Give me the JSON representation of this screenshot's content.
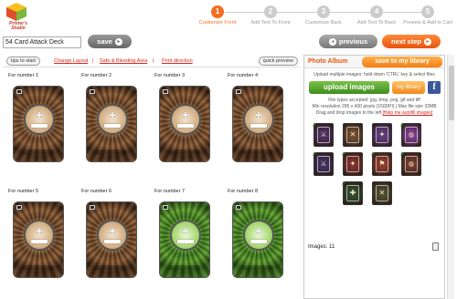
{
  "brand": {
    "name": "Printer's Studio"
  },
  "steps": [
    {
      "num": "1",
      "label": "Customize Front",
      "active": true
    },
    {
      "num": "2",
      "label": "Add Text To Front",
      "active": false
    },
    {
      "num": "3",
      "label": "Customize Back",
      "active": false
    },
    {
      "num": "4",
      "label": "Add Text To Back",
      "active": false
    },
    {
      "num": "5",
      "label": "Preview & Add to Cart",
      "active": false
    }
  ],
  "project": {
    "title": "54 Card Attack Deck",
    "save_label": "save"
  },
  "nav": {
    "previous_label": "previous",
    "next_label": "next step"
  },
  "toolbar": {
    "tips_label": "tips to start",
    "change_layout": "Change Layout",
    "safe_bleed": "Safe & Bleeding Area",
    "print_direction": "Print direction",
    "quick_preview": "quick preview",
    "sep": "|"
  },
  "cards": [
    {
      "label": "For number",
      "num": "1",
      "color": "brown"
    },
    {
      "label": "For number",
      "num": "2",
      "color": "brown"
    },
    {
      "label": "For number",
      "num": "3",
      "color": "brown"
    },
    {
      "label": "For number",
      "num": "4",
      "color": "brown"
    },
    {
      "label": "For number",
      "num": "5",
      "color": "brown"
    },
    {
      "label": "For number",
      "num": "6",
      "color": "brown"
    },
    {
      "label": "For number",
      "num": "7",
      "color": "green"
    },
    {
      "label": "For number",
      "num": "8",
      "color": "green"
    }
  ],
  "album": {
    "title": "Photo Album",
    "save_library": "save to my library",
    "hint": "Upload multiple images: hold down 'CTRL' key & select files",
    "upload_label": "upload images",
    "my_library_label": "my library",
    "facebook": "f",
    "types_line1": "File types accepted: jpg, bmp, png, gif and tiff",
    "types_line2": "Min resolution 295 x 430 pixels (150DPI) | Max file size 32MB",
    "drag_text": "Drag and drop images to the left",
    "help_link": "[Help me autofill images]",
    "images_label": "Images:",
    "images_count": "11",
    "thumbs": [
      {
        "color": "#4a2f5e",
        "sym": "⚔",
        "checked": true
      },
      {
        "color": "#6b4a2f",
        "sym": "✕",
        "checked": false
      },
      {
        "color": "#5a3a7a",
        "sym": "✦",
        "checked": false
      },
      {
        "color": "#7a3a8a",
        "sym": "⦸",
        "checked": true
      },
      {
        "color": "#3e2f5e",
        "sym": "⚔",
        "checked": true
      },
      {
        "color": "#7a2f2f",
        "sym": "✦",
        "checked": true
      },
      {
        "color": "#8a3a2f",
        "sym": "⚑",
        "checked": true
      },
      {
        "color": "#6b3a2f",
        "sym": "⦸",
        "checked": true
      },
      {
        "color": "#2f4a2f",
        "sym": "✚",
        "checked": true
      },
      {
        "color": "#4a4a2f",
        "sym": "✕",
        "checked": false
      }
    ]
  }
}
